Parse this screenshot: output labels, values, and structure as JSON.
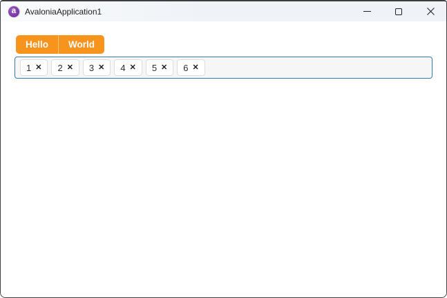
{
  "titlebar": {
    "title": "AvaloniaApplication1",
    "app_icon": {
      "name": "avalonia-logo-icon",
      "letter": "a",
      "color": "#7d3aa6"
    }
  },
  "window_controls": {
    "minimize_icon": "minimize-line",
    "maximize_icon": "maximize-square",
    "close_icon": "close-x"
  },
  "tabs": [
    {
      "label": "Hello"
    },
    {
      "label": "World"
    }
  ],
  "chip_input": {
    "chips": [
      {
        "value": "1"
      },
      {
        "value": "2"
      },
      {
        "value": "3"
      },
      {
        "value": "4"
      },
      {
        "value": "5"
      },
      {
        "value": "6"
      }
    ],
    "remove_glyph": "✕"
  },
  "colors": {
    "tab_accent": "#f7941e",
    "focus_border": "#2e7bae",
    "chip_field_bg": "#f6f6f6",
    "titlebar_bg": "#eff3f7",
    "window_border": "#3e3e3e"
  }
}
